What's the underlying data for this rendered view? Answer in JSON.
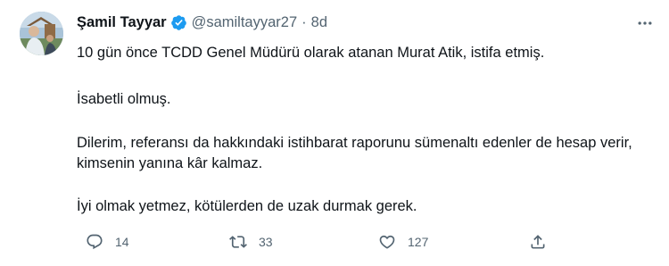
{
  "author": {
    "name": "Şamil Tayyar",
    "handle": "@samiltayyar27",
    "separator": "·",
    "time": "8d",
    "verified_color": "#1d9bf0"
  },
  "tweet": {
    "paragraphs": [
      "10 gün önce TCDD Genel Müdürü olarak atanan Murat Atik, istifa etmiş.",
      "İsabetli olmuş.",
      "Dilerim, referansı da hakkındaki istihbarat raporunu sümenaltı edenler de hesap verir, kimsenin yanına kâr kalmaz.",
      "İyi olmak yetmez, kötülerden de uzak durmak gerek."
    ]
  },
  "actions": {
    "reply_count": "14",
    "retweet_count": "33",
    "like_count": "127"
  },
  "icons": {
    "more": "more-horizontal-icon",
    "reply": "reply-icon",
    "retweet": "retweet-icon",
    "like": "heart-icon",
    "share": "share-icon",
    "verified": "verified-badge-icon"
  },
  "colors": {
    "text": "#0f1419",
    "secondary": "#536471",
    "accent": "#1d9bf0"
  }
}
